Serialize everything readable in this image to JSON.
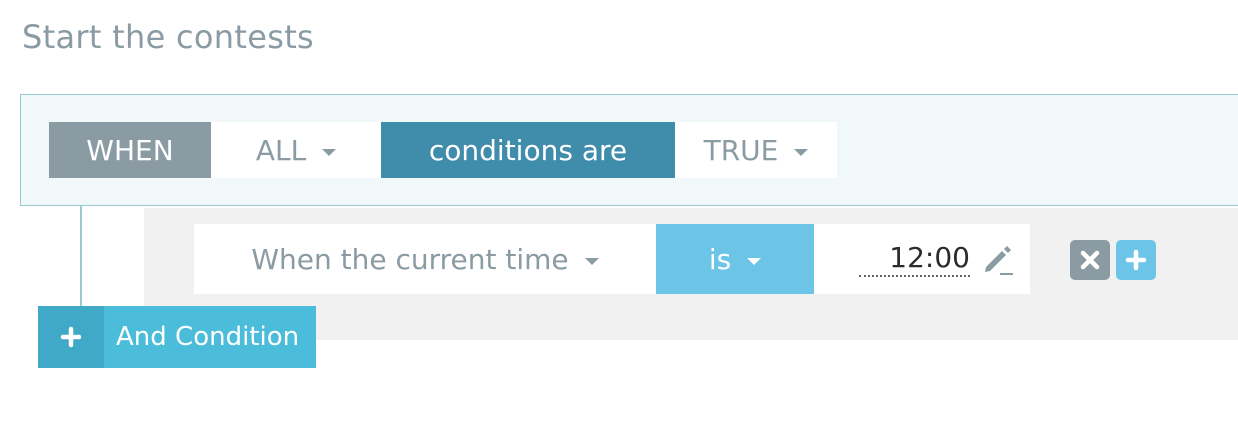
{
  "page": {
    "title": "Start the contests"
  },
  "when_bar": {
    "when_label": "WHEN",
    "quantifier": "ALL",
    "conditions_label": "conditions are",
    "truth_value": "TRUE"
  },
  "condition": {
    "field": "When the current time",
    "operator": "is",
    "value": "12:00"
  },
  "actions": {
    "remove_icon": "close-icon",
    "add_icon": "plus-icon",
    "edit_icon": "pencil-icon",
    "dropdown_icon": "caret-down-icon"
  },
  "and_condition": {
    "label": "And Condition"
  },
  "colors": {
    "title_gray": "#8a9ba4",
    "when_gray": "#8a9ba4",
    "conditions_blue": "#3f8cab",
    "operator_blue": "#6cc5e6",
    "add_button_blue": "#4bbcda",
    "panel_background": "#f1f8fa",
    "panel_border": "#9cc8d4",
    "condition_area": "#f1f1f1"
  }
}
